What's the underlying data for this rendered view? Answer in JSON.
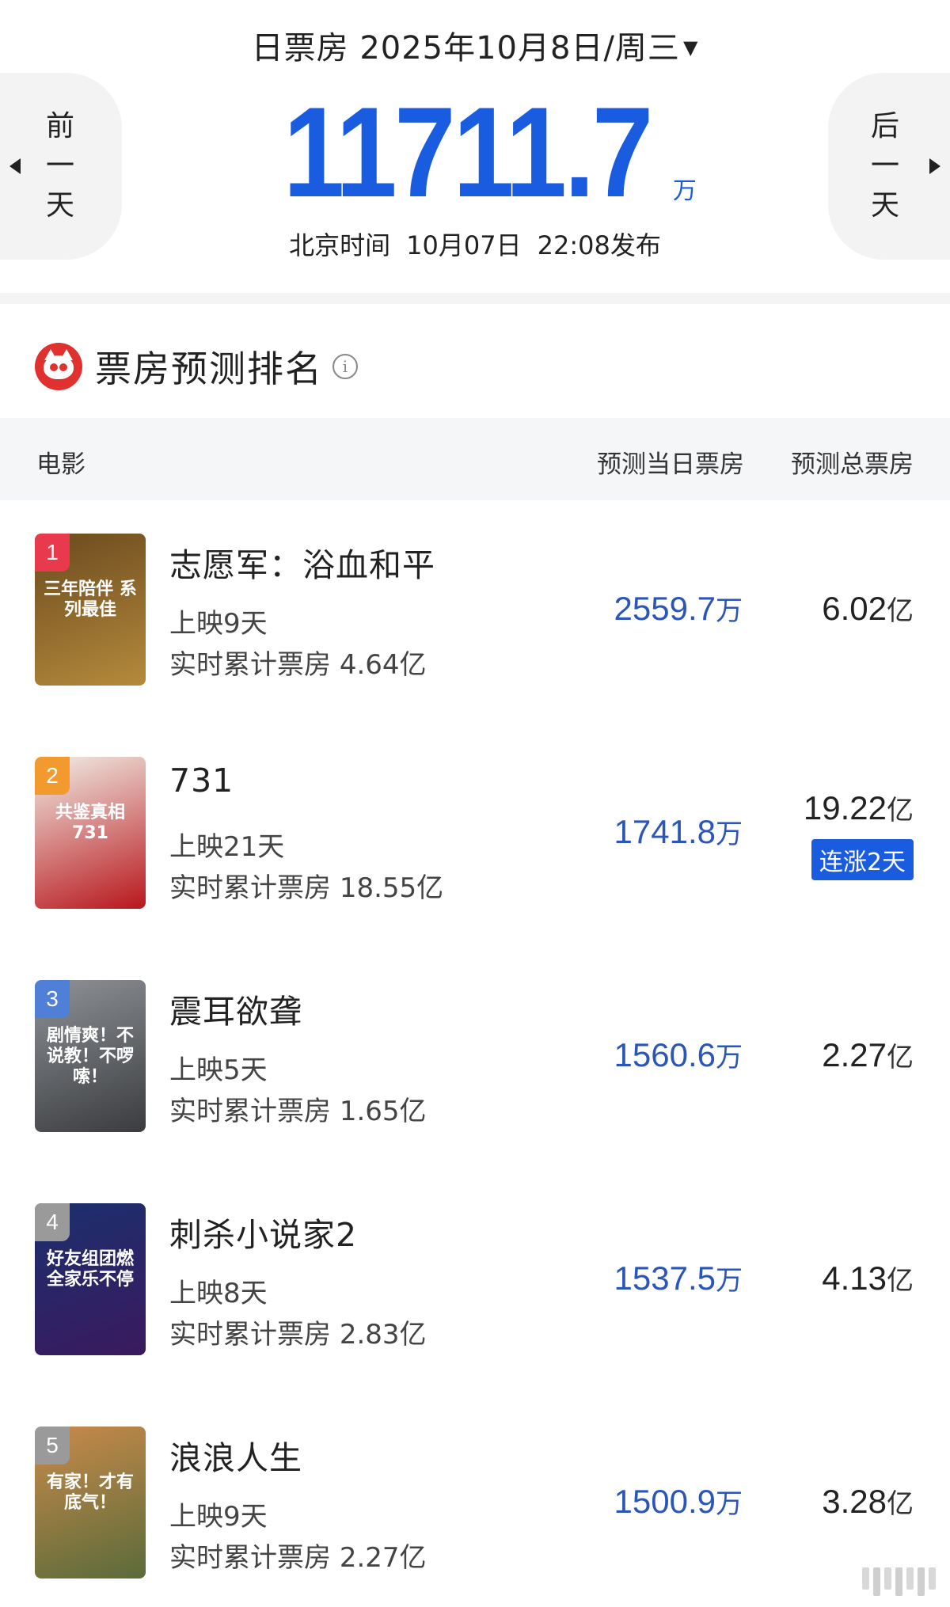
{
  "header": {
    "title": "日票房",
    "date": "2025年10月8日/周三",
    "caret": "▼",
    "total": "11711.7",
    "total_unit": "万",
    "publish_prefix": "北京时间",
    "publish_date": "10月07日",
    "publish_time": "22:08发布",
    "prev_day": [
      "前",
      "一",
      "天"
    ],
    "next_day": [
      "后",
      "一",
      "天"
    ]
  },
  "section": {
    "title": "票房预测排名",
    "info": "i"
  },
  "table": {
    "col_movie": "电影",
    "col_daily": "预测当日票房",
    "col_total": "预测总票房"
  },
  "movies": [
    {
      "rank": "1",
      "rank_color": "#e83a4c",
      "poster_colors": [
        "#6b4a1e",
        "#b58a3c"
      ],
      "poster_text": "三年陪伴 系列最佳",
      "name": "志愿军：浴血和平",
      "days": "上映9天",
      "cum_label": "实时累计票房",
      "cum": "4.64亿",
      "daily": "2559.7",
      "daily_unit": "万",
      "total": "6.02",
      "total_unit": "亿",
      "badge": ""
    },
    {
      "rank": "2",
      "rank_color": "#f29a2e",
      "poster_colors": [
        "#f1eee6",
        "#b8171c"
      ],
      "poster_text": "共鉴真相 731",
      "name": "731",
      "days": "上映21天",
      "cum_label": "实时累计票房",
      "cum": "18.55亿",
      "daily": "1741.8",
      "daily_unit": "万",
      "total": "19.22",
      "total_unit": "亿",
      "badge": "连涨2天"
    },
    {
      "rank": "3",
      "rank_color": "#4f7fd6",
      "poster_colors": [
        "#8e9196",
        "#3a3c3f"
      ],
      "poster_text": "剧情爽！不说教！不啰嗦！",
      "name": "震耳欲聋",
      "days": "上映5天",
      "cum_label": "实时累计票房",
      "cum": "1.65亿",
      "daily": "1560.6",
      "daily_unit": "万",
      "total": "2.27",
      "total_unit": "亿",
      "badge": ""
    },
    {
      "rank": "4",
      "rank_color": "#9a9a9a",
      "poster_colors": [
        "#1b2f6e",
        "#3a1a5e"
      ],
      "poster_text": "好友组团燃 全家乐不停",
      "name": "刺杀小说家2",
      "days": "上映8天",
      "cum_label": "实时累计票房",
      "cum": "2.83亿",
      "daily": "1537.5",
      "daily_unit": "万",
      "total": "4.13",
      "total_unit": "亿",
      "badge": ""
    },
    {
      "rank": "5",
      "rank_color": "#9a9a9a",
      "poster_colors": [
        "#c98a4a",
        "#5a6b3a"
      ],
      "poster_text": "有家！才有底气！",
      "name": "浪浪人生",
      "days": "上映9天",
      "cum_label": "实时累计票房",
      "cum": "2.27亿",
      "daily": "1500.9",
      "daily_unit": "万",
      "total": "3.28",
      "total_unit": "亿",
      "badge": ""
    }
  ]
}
